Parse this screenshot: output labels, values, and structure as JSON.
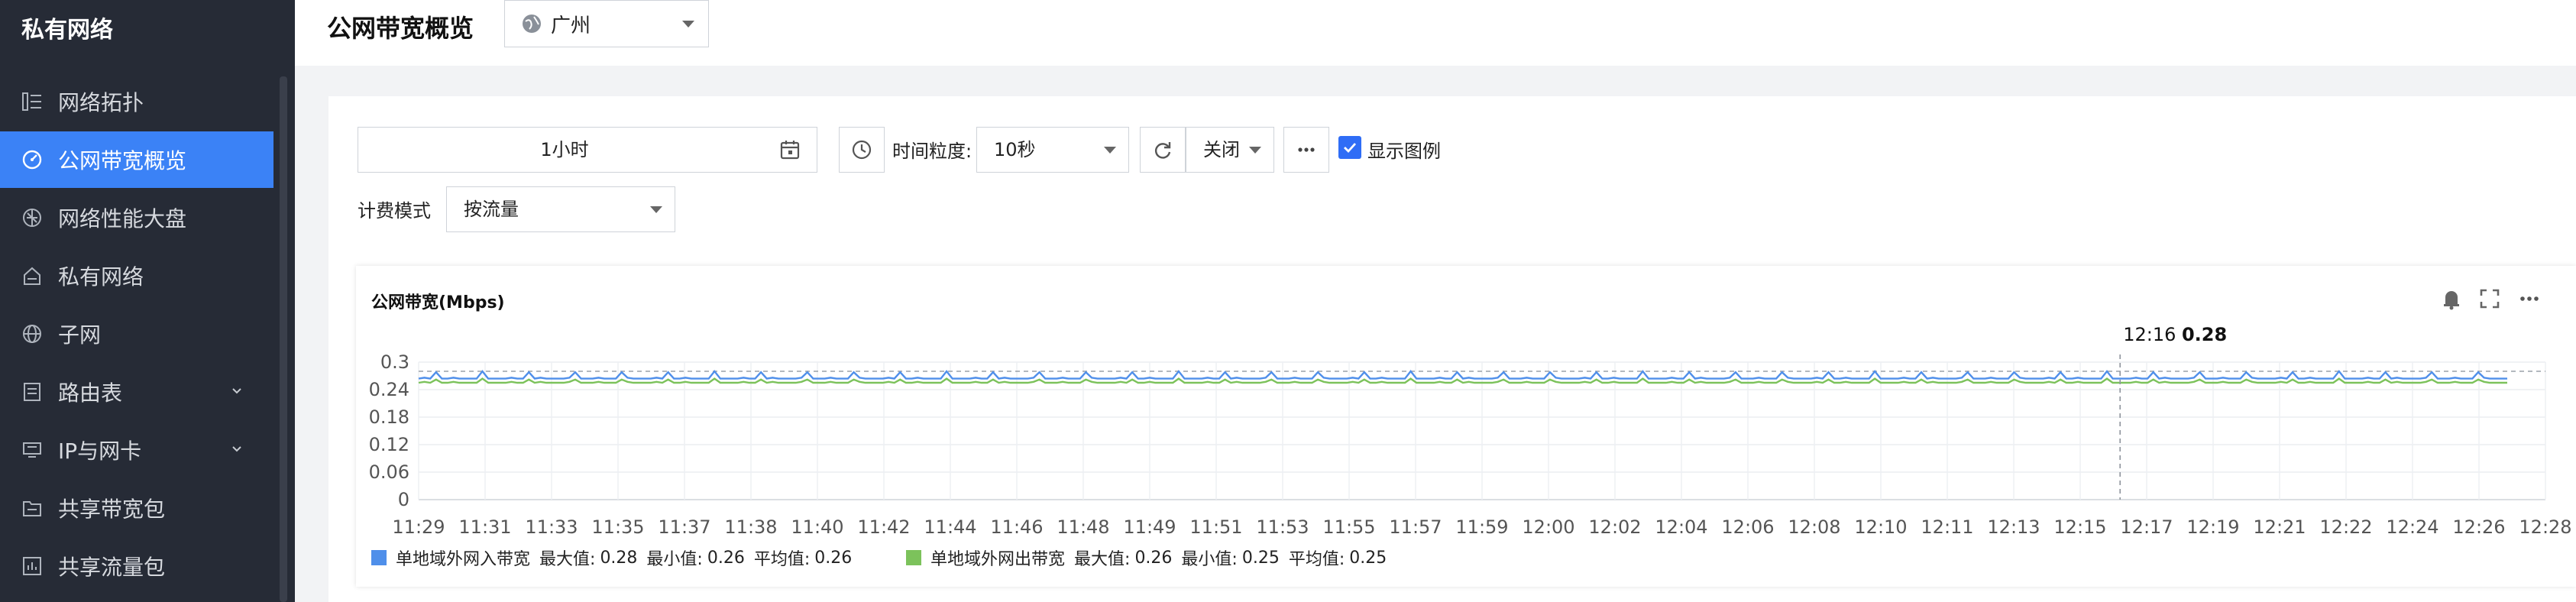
{
  "app": {
    "brand": "私有网络"
  },
  "sidebar": {
    "items": [
      {
        "label": "网络拓扑",
        "icon": "topology-icon",
        "active": false,
        "expandable": false
      },
      {
        "label": "公网带宽概览",
        "icon": "bandwidth-gauge-icon",
        "active": true,
        "expandable": false
      },
      {
        "label": "网络性能大盘",
        "icon": "performance-icon",
        "active": false,
        "expandable": false
      },
      {
        "label": "私有网络",
        "icon": "house-icon",
        "active": false,
        "expandable": false
      },
      {
        "label": "子网",
        "icon": "globe-icon",
        "active": false,
        "expandable": false
      },
      {
        "label": "路由表",
        "icon": "route-table-icon",
        "active": false,
        "expandable": true
      },
      {
        "label": "IP与网卡",
        "icon": "nic-icon",
        "active": false,
        "expandable": true
      },
      {
        "label": "共享带宽包",
        "icon": "folder-icon",
        "active": false,
        "expandable": false
      },
      {
        "label": "共享流量包",
        "icon": "bar-chart-icon",
        "active": false,
        "expandable": false
      }
    ]
  },
  "header": {
    "title": "公网带宽概览",
    "region": "广州"
  },
  "toolbar": {
    "time_range": "1小时",
    "granularity_label": "时间粒度:",
    "granularity_value": "10秒",
    "refresh_value": "关闭",
    "show_legend_label": "显示图例",
    "show_legend_checked": true,
    "billing_label": "计费模式",
    "billing_value": "按流量"
  },
  "chart_data": {
    "type": "line",
    "title": "公网带宽(Mbps)",
    "xlabel": "",
    "ylabel": "",
    "ylim": [
      0,
      0.3
    ],
    "yticks": [
      "0.3",
      "0.24",
      "0.18",
      "0.12",
      "0.06",
      "0"
    ],
    "x_tick_labels": [
      "11:29",
      "11:31",
      "11:33",
      "11:35",
      "11:37",
      "11:38",
      "11:40",
      "11:42",
      "11:44",
      "11:46",
      "11:48",
      "11:49",
      "11:51",
      "11:53",
      "11:55",
      "11:57",
      "11:59",
      "12:00",
      "12:02",
      "12:04",
      "12:06",
      "12:08",
      "12:10",
      "12:11",
      "12:13",
      "12:15",
      "12:17",
      "12:19",
      "12:21",
      "12:22",
      "12:24",
      "12:26",
      "12:28"
    ],
    "grid": true,
    "legend_position": "bottom-left",
    "series": [
      {
        "name": "单地域外网入带宽",
        "color": "#4f8fea",
        "max": "0.28",
        "min": "0.26",
        "avg": "0.26",
        "base": 0.264,
        "spike": 0.278
      },
      {
        "name": "单地域外网出带宽",
        "color": "#7cc25b",
        "max": "0.26",
        "min": "0.25",
        "avg": "0.25",
        "base": 0.255,
        "spike": 0.262
      }
    ],
    "stat_labels": {
      "max": "最大值:",
      "min": "最小值:",
      "avg": "平均值:"
    },
    "tooltip": {
      "time": "12:16",
      "value": "0.28",
      "x_index": 25.6
    },
    "reference_line": 0.28
  }
}
